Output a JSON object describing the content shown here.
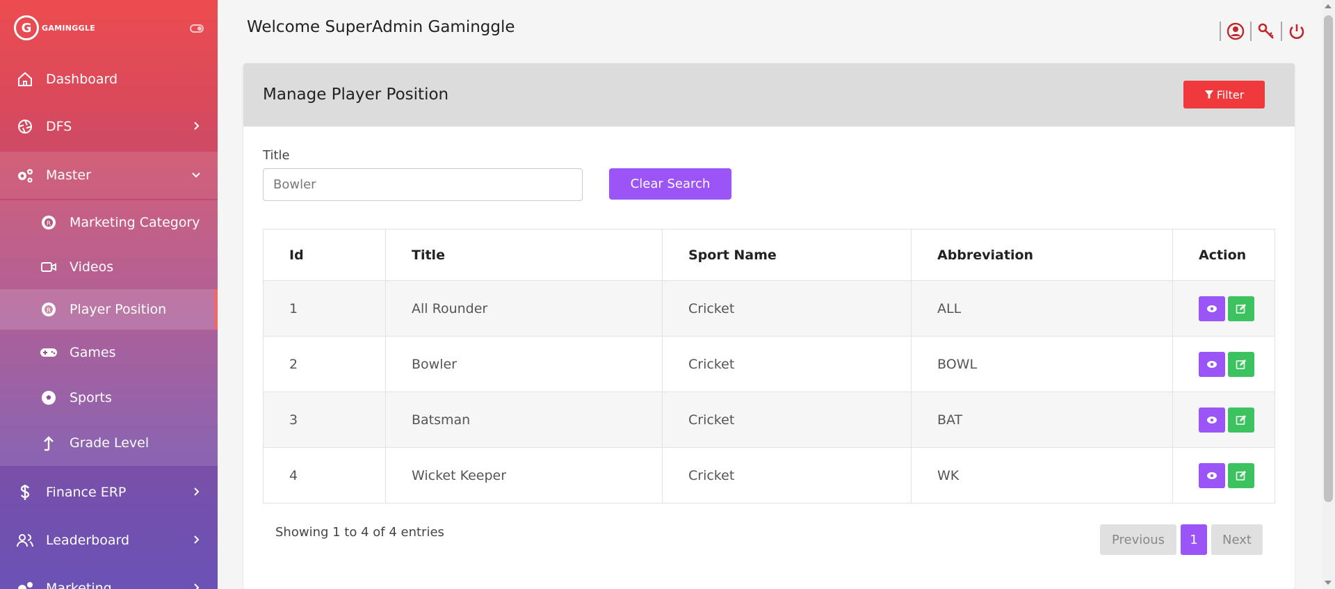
{
  "brand": {
    "logo_letter": "G",
    "name": "GAMINGGLE"
  },
  "sidebar": {
    "items": [
      {
        "label": "Dashboard"
      },
      {
        "label": "DFS"
      },
      {
        "label": "Master"
      },
      {
        "label": "Marketing Category"
      },
      {
        "label": "Videos"
      },
      {
        "label": "Player Position"
      },
      {
        "label": "Games"
      },
      {
        "label": "Sports"
      },
      {
        "label": "Grade Level"
      },
      {
        "label": "Finance ERP"
      },
      {
        "label": "Leaderboard"
      },
      {
        "label": "Marketing"
      }
    ]
  },
  "header": {
    "welcome": "Welcome SuperAdmin Gaminggle"
  },
  "card": {
    "title": "Manage Player Position",
    "filter_label": "Filter",
    "field_label": "Title",
    "search_value": "Bowler",
    "clear_label": "Clear Search"
  },
  "table": {
    "headers": [
      "Id",
      "Title",
      "Sport Name",
      "Abbreviation",
      "Action"
    ],
    "rows": [
      {
        "id": "1",
        "title": "All Rounder",
        "sport": "Cricket",
        "abbr": "ALL"
      },
      {
        "id": "2",
        "title": "Bowler",
        "sport": "Cricket",
        "abbr": "BOWL"
      },
      {
        "id": "3",
        "title": "Batsman",
        "sport": "Cricket",
        "abbr": "BAT"
      },
      {
        "id": "4",
        "title": "Wicket Keeper",
        "sport": "Cricket",
        "abbr": "WK"
      }
    ]
  },
  "footer": {
    "entries": "Showing 1 to 4 of 4 entries",
    "prev": "Previous",
    "page": "1",
    "next": "Next"
  },
  "colors": {
    "accent": "#9b55f6",
    "edit": "#3cc25e",
    "filter": "#f0393c",
    "sidebar_top": "#ec4c4f",
    "sidebar_bottom": "#6a52b6"
  }
}
